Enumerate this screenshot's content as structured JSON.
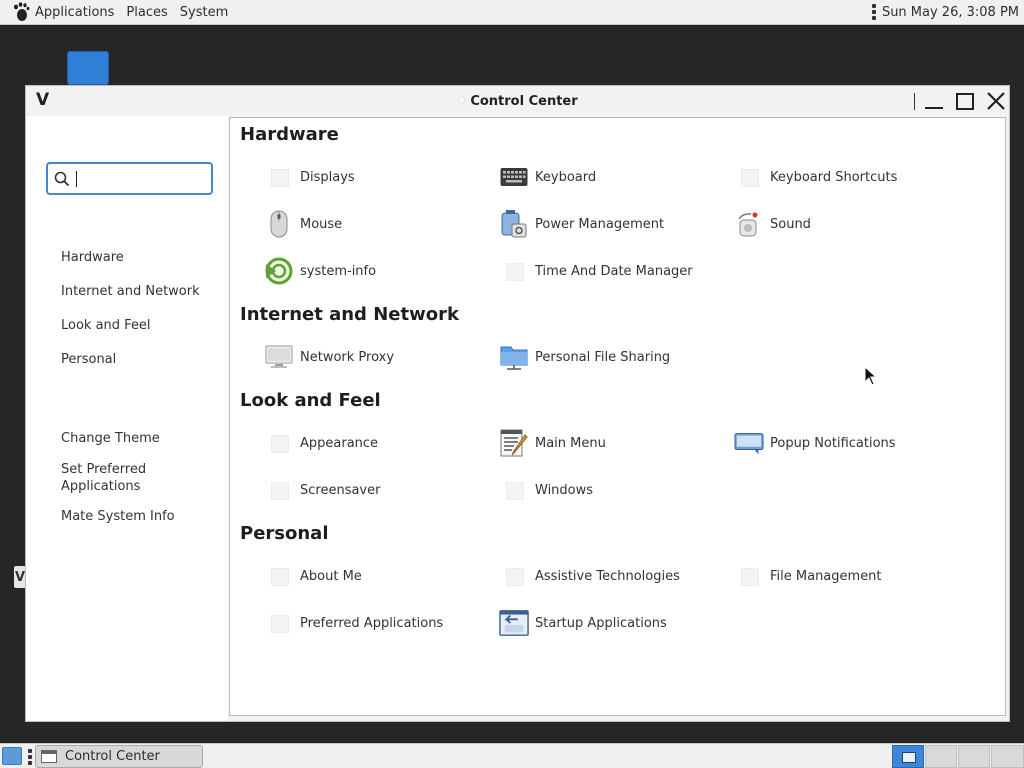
{
  "top_panel": {
    "menus": [
      "Applications",
      "Places",
      "System"
    ],
    "clock": "Sun May 26,  3:08 PM"
  },
  "window": {
    "title": "Control Center"
  },
  "sidebar": {
    "search_value": "",
    "categories": [
      "Hardware",
      "Internet and Network",
      "Look and Feel",
      "Personal"
    ],
    "tasks": [
      "Change Theme",
      "Set Preferred Applications",
      "Mate System Info"
    ]
  },
  "sections": [
    {
      "title": "Hardware",
      "items": [
        "Displays",
        "Keyboard",
        "Keyboard Shortcuts",
        "Mouse",
        "Power Management",
        "Sound",
        "system-info",
        "Time And Date Manager"
      ]
    },
    {
      "title": "Internet and Network",
      "items": [
        "Network Proxy",
        "Personal File Sharing"
      ]
    },
    {
      "title": "Look and Feel",
      "items": [
        "Appearance",
        "Main Menu",
        "Popup Notifications",
        "Screensaver",
        "Windows"
      ]
    },
    {
      "title": "Personal",
      "items": [
        "About Me",
        "Assistive Technologies",
        "File Management",
        "Preferred Applications",
        "Startup Applications"
      ]
    }
  ],
  "bottom_panel": {
    "task_label": "Control Center"
  },
  "icons": {
    "app_logo": "gnome-foot-icon",
    "window_glyph": "V"
  },
  "colors": {
    "accent": "#4a86c5",
    "desktop": "#262626",
    "workspace_active": "#3d86d9"
  }
}
